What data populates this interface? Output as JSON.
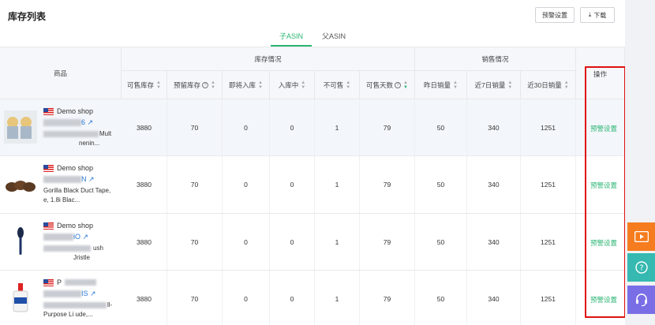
{
  "page": {
    "title": "库存列表"
  },
  "toolbar": {
    "alert_button": "预警设置",
    "download_icon": "download-icon",
    "download_button": "下载"
  },
  "tabs": [
    {
      "label": "子ASIN",
      "active": true
    },
    {
      "label": "父ASIN",
      "active": false
    }
  ],
  "table": {
    "product_header": "商品",
    "inventory_group": "库存情况",
    "sales_group": "销售情况",
    "operation_header": "操作",
    "columns": [
      "可售库存",
      "预留库存",
      "即将入库",
      "入库中",
      "不可售",
      "可售天数",
      "昨日销量",
      "近7日销量",
      "近30日销量"
    ],
    "rows": [
      {
        "shop": "Demo shop",
        "asin_suffix": "6",
        "title_fragment": "Mult",
        "title_line2": "nenin...",
        "values": [
          "3880",
          "70",
          "0",
          "0",
          "1",
          "79",
          "50",
          "340",
          "1251"
        ],
        "action": "预警设置"
      },
      {
        "shop": "Demo shop",
        "asin_suffix": "N",
        "title_fragment": "Gorilla Black Duct Tape,",
        "title_line2": "e, 1.8i  Blac...",
        "values": [
          "3880",
          "70",
          "0",
          "0",
          "1",
          "79",
          "50",
          "340",
          "1251"
        ],
        "action": "预警设置"
      },
      {
        "shop": "Demo shop",
        "asin_suffix": "iO",
        "title_fragment": "ush",
        "title_line2": "Jristle",
        "values": [
          "3880",
          "70",
          "0",
          "0",
          "1",
          "79",
          "50",
          "340",
          "1251"
        ],
        "action": "预警设置"
      },
      {
        "shop": "P",
        "asin_suffix": "IS",
        "title_fragment": "ll-",
        "title_line2": "Purpose Li  ude,...",
        "values": [
          "3880",
          "70",
          "0",
          "0",
          "1",
          "79",
          "50",
          "340",
          "1251"
        ],
        "action": "预警设置"
      }
    ]
  },
  "float_buttons": {
    "play": "play-icon",
    "help": "help-icon",
    "service": "headset-icon"
  },
  "colors": {
    "accent": "#2bb673",
    "link": "#2b78d6",
    "highlight": "#e01010"
  }
}
